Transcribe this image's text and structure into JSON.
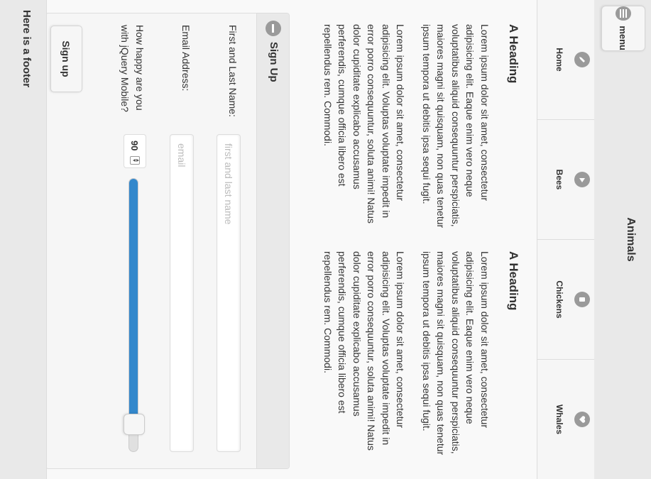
{
  "header": {
    "title": "Animals",
    "menu_label": "menu"
  },
  "navbar": {
    "items": [
      {
        "label": "Home",
        "icon": "edit-icon"
      },
      {
        "label": "Bees",
        "icon": "play-icon"
      },
      {
        "label": "Chickens",
        "icon": "tablet-icon"
      },
      {
        "label": "Whales",
        "icon": "heart-icon"
      }
    ]
  },
  "content": {
    "blocks": [
      {
        "heading": "A Heading",
        "paragraphs": [
          "Lorem ipsum dolor sit amet, consectetur adipisicing elit. Eaque enim vero neque voluptatibus aliquid consequuntur perspiciatis, maiores magni sit quisquam, non quas tenetur ipsum tempora ut debitis ipsa sequi fugit.",
          "Lorem ipsum dolor sit amet, consectetur adipisicing elit. Voluptas voluptate impedit in error porro consequuntur, soluta animi! Natus dolor cupiditate explicabo accusamus perferendis, cumque officia libero est repellendus rem. Commodi."
        ]
      },
      {
        "heading": "A Heading",
        "paragraphs": [
          "Lorem ipsum dolor sit amet, consectetur adipisicing elit. Eaque enim vero neque voluptatibus aliquid consequuntur perspiciatis, maiores magni sit quisquam, non quas tenetur ipsum tempora ut debitis ipsa sequi fugit.",
          "Lorem ipsum dolor sit amet, consectetur adipisicing elit. Voluptas voluptate impedit in error porro consequuntur, soluta animi! Natus dolor cupiditate explicabo accusamus perferendis, cumque officia libero est repellendus rem. Commodi."
        ]
      }
    ]
  },
  "signup": {
    "title": "Sign Up",
    "name_label": "First and Last Name:",
    "name_placeholder": "first and last name",
    "email_label": "Email Address:",
    "email_placeholder": "email",
    "happy_label": "How happy are you with jQuery Mobile?",
    "happy_value": "90",
    "happy_level": 0.9,
    "submit_label": "Sign up"
  },
  "footer": {
    "text": "Here is a footer"
  },
  "colors": {
    "accent": "#3388cc",
    "bar": "#e9e9e9",
    "icon": "#9a9a9a"
  }
}
